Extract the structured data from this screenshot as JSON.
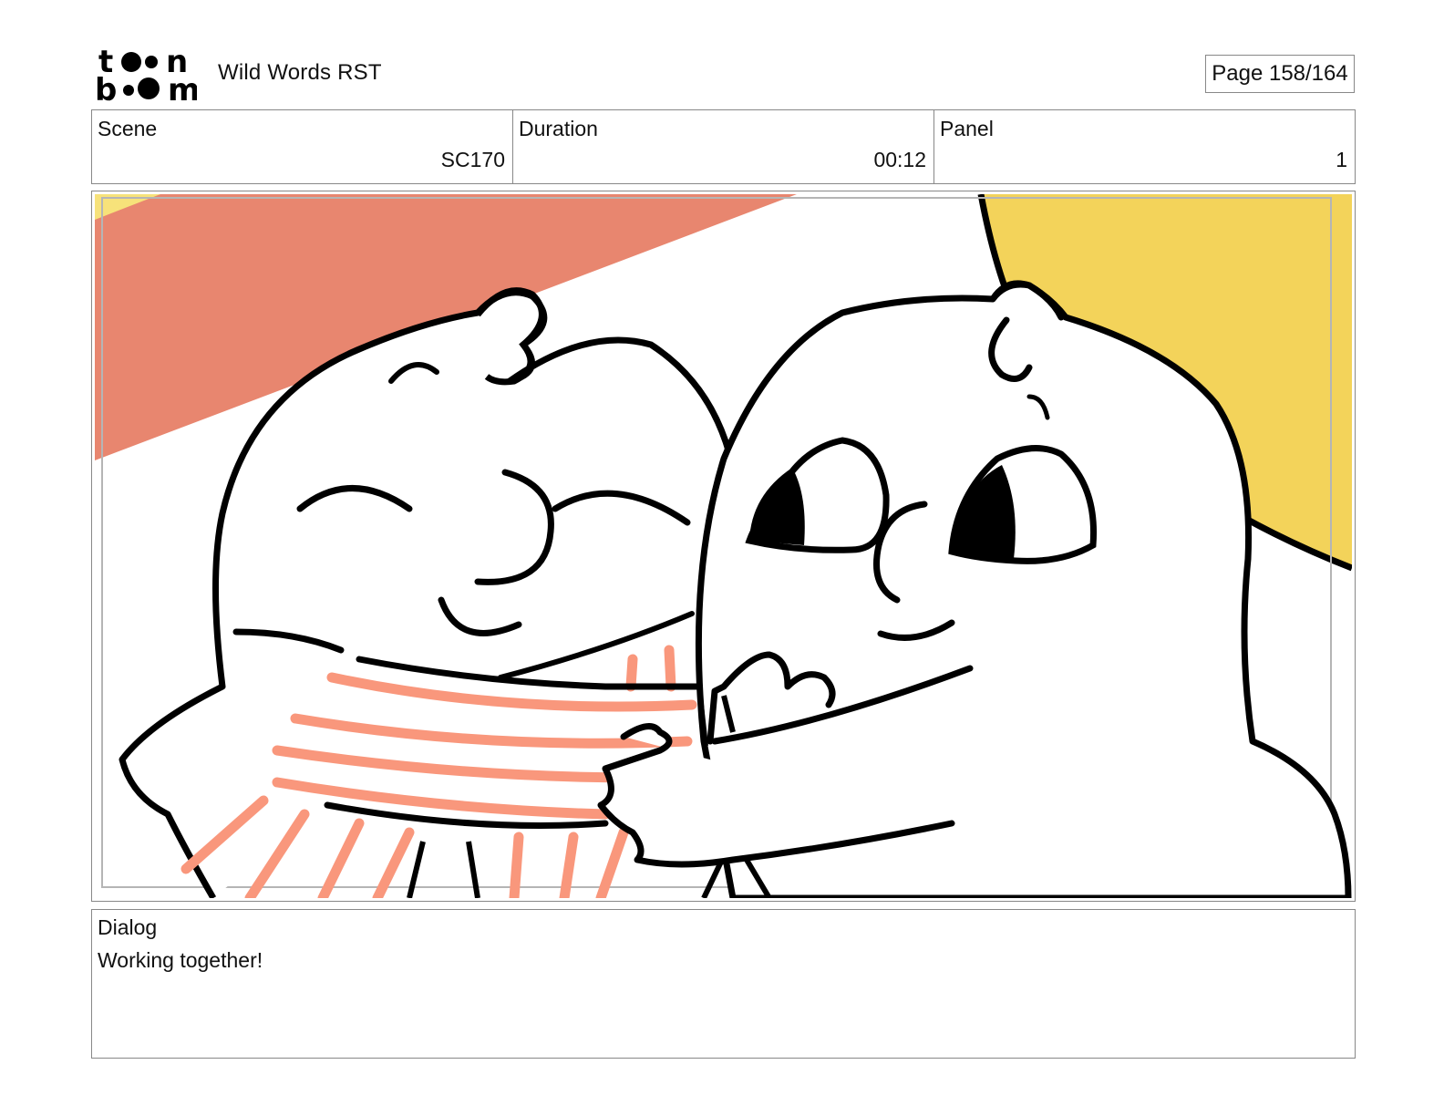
{
  "header": {
    "logo_text": "toon boom",
    "project_title": "Wild Words RST",
    "page_indicator": "Page 158/164"
  },
  "info": {
    "scene_label": "Scene",
    "scene_value": "SC170",
    "duration_label": "Duration",
    "duration_value": "00:12",
    "panel_label": "Panel",
    "panel_value": "1"
  },
  "panel_image": {
    "description_icon": "storyboard-drawing-icon",
    "colors": {
      "salmon": "#e8866f",
      "yellow": "#f3d35a",
      "stripe": "#f9977c",
      "ink": "#000000"
    }
  },
  "dialog": {
    "label": "Dialog",
    "text": "Working together!"
  }
}
